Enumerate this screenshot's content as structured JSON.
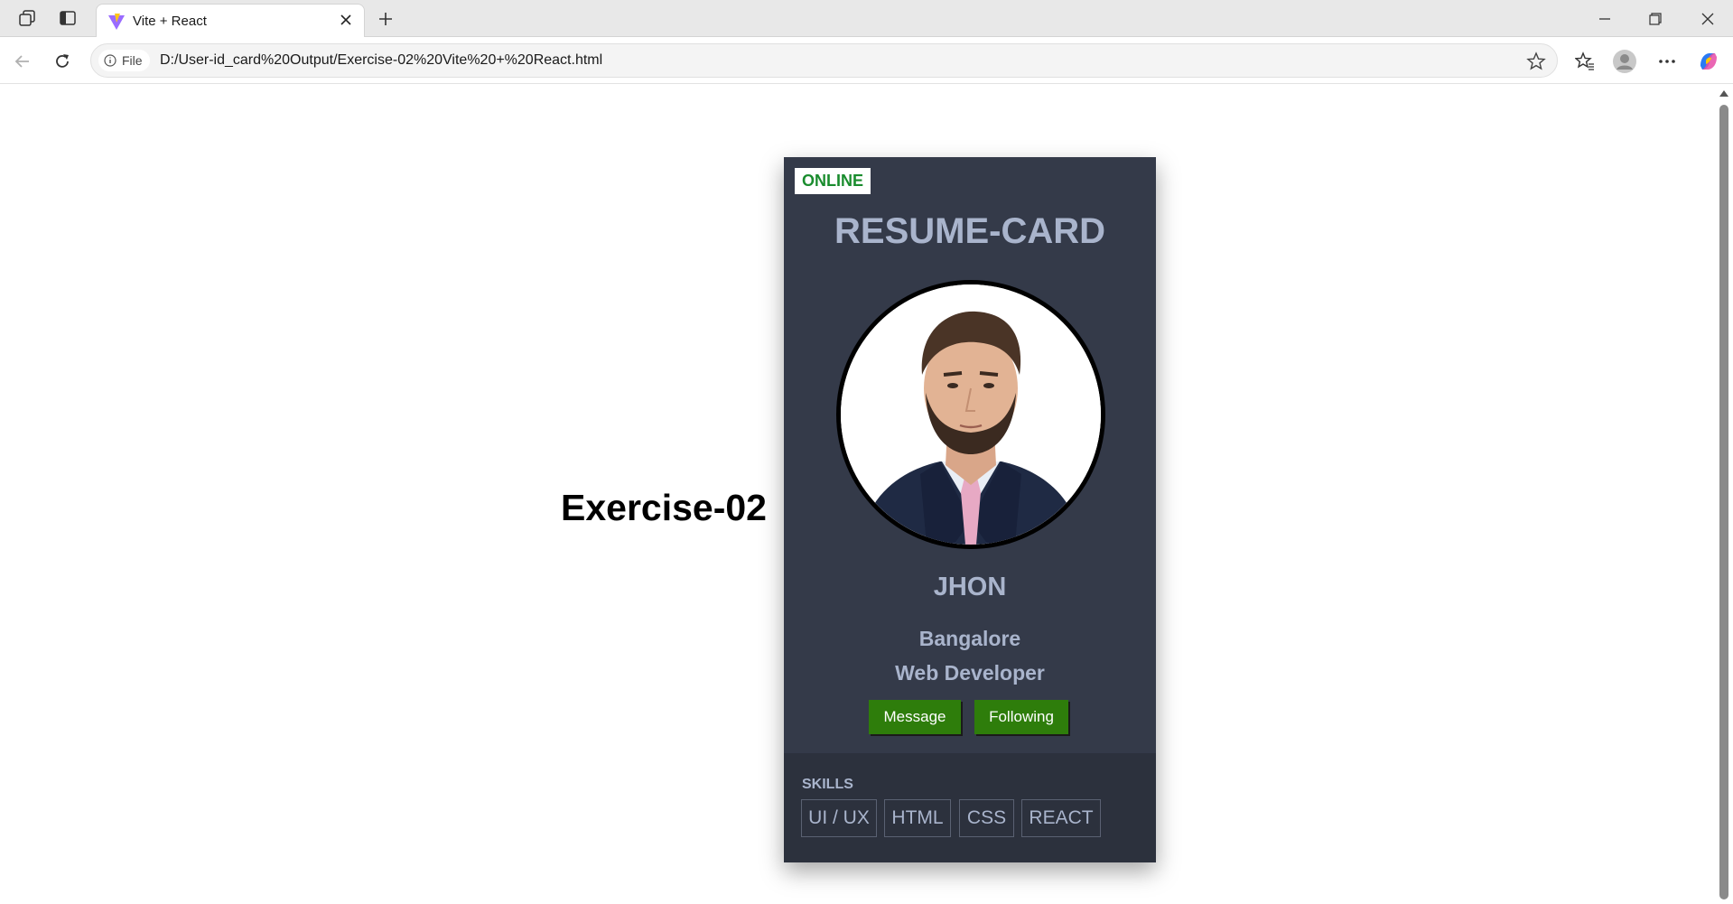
{
  "browser": {
    "tab_title": "Vite + React",
    "address": {
      "scheme_chip": "File",
      "url": "D:/User-id_card%20Output/Exercise-02%20Vite%20+%20React.html"
    }
  },
  "page": {
    "heading": "Exercise-02",
    "card": {
      "status": "ONLINE",
      "title": "RESUME-CARD",
      "name": "JHON",
      "city": "Bangalore",
      "role": "Web Developer",
      "buttons": {
        "message": "Message",
        "following": "Following"
      },
      "skills": {
        "label": "SKILLS",
        "items": [
          "UI / UX",
          "HTML",
          "CSS",
          "REACT"
        ]
      }
    }
  },
  "colors": {
    "card_bg": "#343a49",
    "skills_bg": "#2c313d",
    "text_accent": "#a9b4cc",
    "button_green": "#2e7d0b",
    "online_green": "#1a8c2e"
  }
}
